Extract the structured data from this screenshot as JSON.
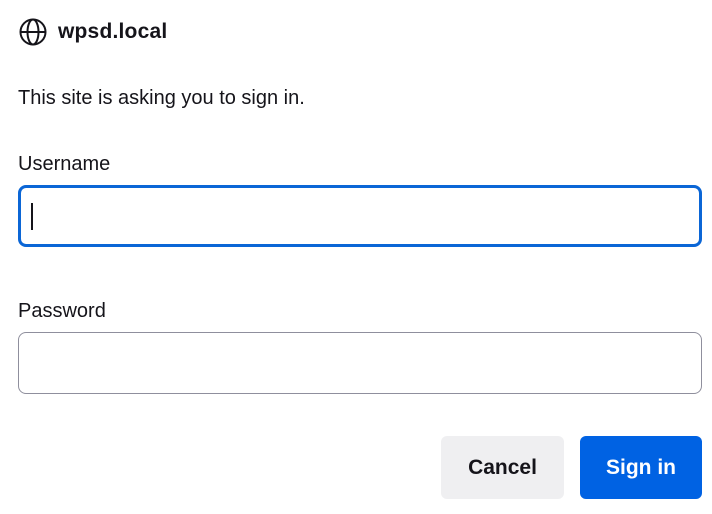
{
  "dialog": {
    "site": "wpsd.local",
    "site_icon": "globe-icon",
    "message": "This site is asking you to sign in.",
    "username": {
      "label": "Username",
      "value": "",
      "focused": true
    },
    "password": {
      "label": "Password",
      "value": ""
    },
    "buttons": {
      "cancel_label": "Cancel",
      "signin_label": "Sign in"
    }
  },
  "colors": {
    "focus_border": "#0b66d6",
    "primary_button": "#0062e3",
    "secondary_button": "#efeff1",
    "text": "#15141a"
  }
}
